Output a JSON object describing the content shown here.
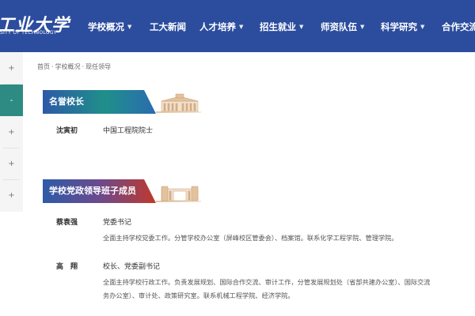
{
  "header": {
    "logo_cn": "工业大学",
    "logo_en": "SITY OF TECHNOLOGY",
    "nav": [
      {
        "label": "学校概况",
        "has_dropdown": true
      },
      {
        "label": "工大新闻",
        "has_dropdown": false
      },
      {
        "label": "人才培养",
        "has_dropdown": true
      },
      {
        "label": "招生就业",
        "has_dropdown": true
      },
      {
        "label": "师资队伍",
        "has_dropdown": true
      },
      {
        "label": "科学研究",
        "has_dropdown": true
      },
      {
        "label": "合作交流",
        "has_dropdown": false
      }
    ],
    "caret": "▼"
  },
  "sidebar": {
    "buttons": [
      "+",
      "-",
      "+",
      "+",
      "+"
    ],
    "active_index": 1
  },
  "breadcrumb": {
    "items": [
      "首页",
      "学校概况",
      "现任领导"
    ],
    "separator": "·"
  },
  "sections": [
    {
      "title": "名誉校长",
      "people": [
        {
          "name": "沈寅初",
          "title": "中国工程院院士",
          "duties": []
        }
      ]
    },
    {
      "title": "学校党政领导班子成员",
      "people": [
        {
          "name": "蔡袁强",
          "title": "党委书记",
          "duties": [
            "全面主持学校党委工作。分管学校办公室（屏峰校区管委会）、档案馆。联系化学工程学院、管理学院。"
          ]
        },
        {
          "name": "高　翔",
          "title": "校长、党委副书记",
          "duties": [
            "全面主持学校行政工作。负责发展规划、国际合作交流、审计工作，分管发展规划处（省部共建办公室）、国际交流",
            "务办公室）、审计处、政策研究室。联系机械工程学院、经济学院。"
          ]
        }
      ]
    }
  ],
  "colors": {
    "header_bg": "#2c4d9e",
    "sidebar_active": "#2e8b84",
    "banner_start": "#2d5aa8",
    "banner_end": "#c0392b"
  }
}
